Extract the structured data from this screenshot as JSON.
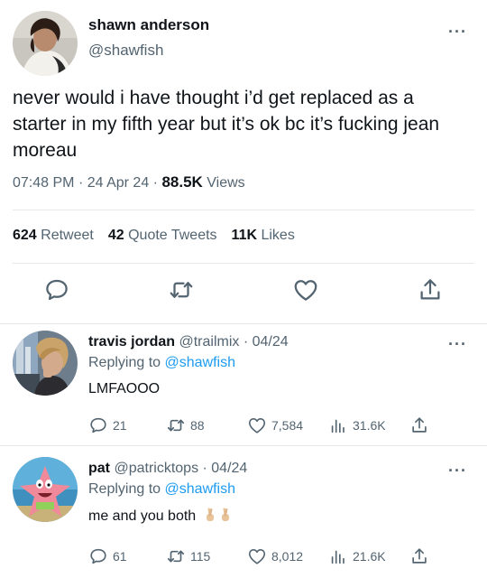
{
  "main_tweet": {
    "author_name": "shawn anderson",
    "author_handle": "@shawfish",
    "text": "never would i have thought i’d get replaced as a starter in my fifth year but it’s ok bc it’s fucking jean moreau",
    "time": "07:48 PM",
    "date": "24 Apr 24",
    "views_count": "88.5K",
    "views_label": "Views",
    "retweets_count": "624",
    "retweets_label": "Retweet",
    "quotes_count": "42",
    "quotes_label": "Quote Tweets",
    "likes_count": "11K",
    "likes_label": "Likes"
  },
  "replies": [
    {
      "name": "travis jordan",
      "handle": "@trailmix",
      "date": "04/24",
      "replying_prefix": "Replying to",
      "replying_to": "@shawfish",
      "text": "LMFAOOO",
      "reply_count": "21",
      "retweet_count": "88",
      "like_count": "7,584",
      "view_count": "31.6K"
    },
    {
      "name": "pat",
      "handle": "@patricktops",
      "date": "04/24",
      "replying_prefix": "Replying to",
      "replying_to": "@shawfish",
      "text": "me and you both",
      "reply_count": "61",
      "retweet_count": "115",
      "like_count": "8,012",
      "view_count": "21.6K"
    }
  ],
  "icons": {
    "reply": "reply-icon",
    "retweet": "retweet-icon",
    "like": "heart-icon",
    "views": "views-icon",
    "share": "share-icon",
    "more": "more-icon",
    "emoji": "crossed-fingers-emoji"
  },
  "colors": {
    "text": "#0f1419",
    "secondary": "#536471",
    "link": "#1d9bf0",
    "divider": "#e6e9eb"
  }
}
